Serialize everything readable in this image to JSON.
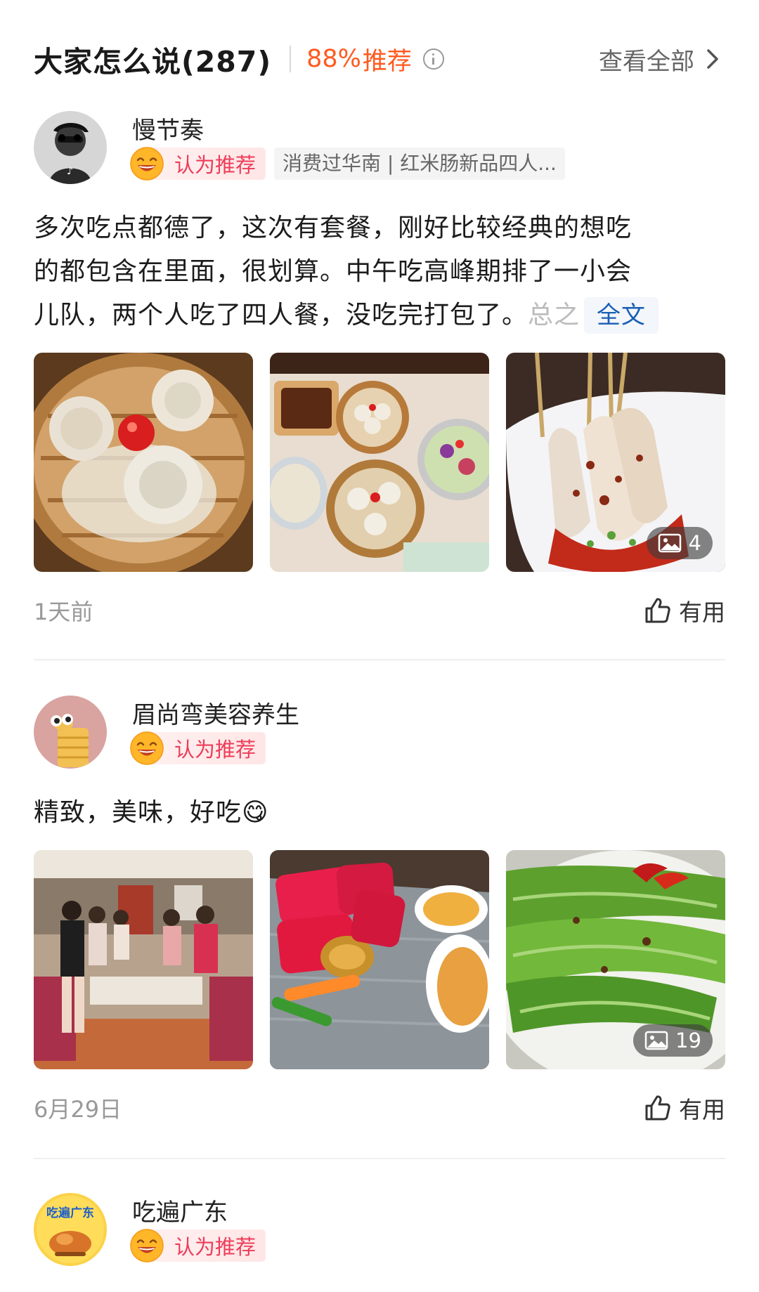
{
  "header": {
    "title": "大家怎么说(287)",
    "recommend_percent": "88%",
    "recommend_label": "推荐",
    "info_icon": "info-icon",
    "view_all_label": "查看全部",
    "chevron_icon": "chevron-right-icon"
  },
  "reviews": [
    {
      "author": "慢节奏",
      "badge_label": "认为推荐",
      "badge_icon": "smile-face-icon",
      "tag": "消费过华南 | 红米肠新品四人...",
      "text_lines": [
        "多次吃点都德了，这次有套餐，刚好比较经典的想吃",
        "的都包含在里面，很划算。中午吃高峰期排了一小会",
        "儿队，两个人吃了四人餐，没吃完打包了。"
      ],
      "faded_text": "总之",
      "fulltext_label": "全文",
      "photo_count": "4",
      "time": "1天前",
      "useful_label": "有用"
    },
    {
      "author": "眉尚弯美容养生",
      "badge_label": "认为推荐",
      "badge_icon": "smile-face-icon",
      "text": "精致，美味，好吃😋",
      "photo_count": "19",
      "time": "6月29日",
      "useful_label": "有用"
    },
    {
      "author": "吃遍广东",
      "avatar_text": "吃遍广东",
      "badge_label": "认为推荐",
      "badge_icon": "smile-face-icon"
    }
  ],
  "colors": {
    "accent_orange": "#ff5a1f",
    "badge_red": "#ec3d5a",
    "link_blue": "#1a5fb4",
    "muted_gray": "#999999"
  }
}
